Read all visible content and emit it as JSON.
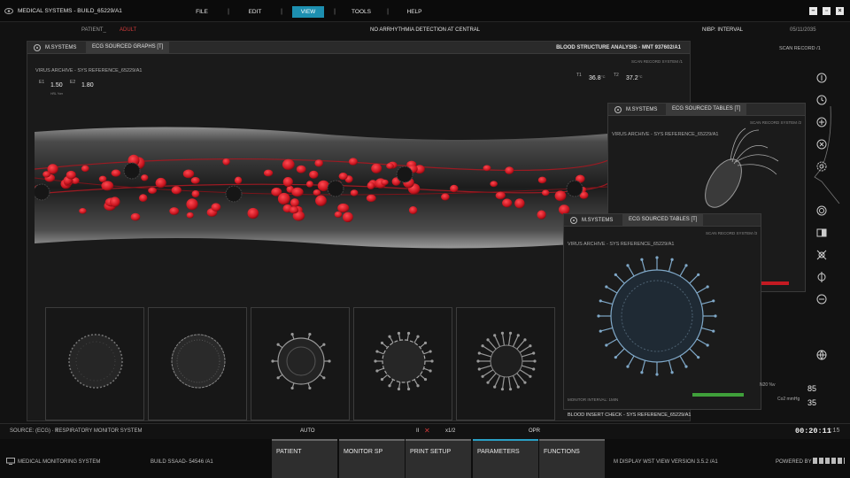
{
  "app": {
    "title": "MEDICAL SYSTEMS - BUILD_65229/A1"
  },
  "menu": [
    {
      "label": "FILE"
    },
    {
      "label": "EDIT"
    },
    {
      "label": "VIEW"
    },
    {
      "label": "TOOLS"
    },
    {
      "label": "HELP"
    }
  ],
  "status": {
    "patient": "PATIENT_",
    "adult": "ADULT",
    "center": "NO ARRHYTHMIA DETECTION AT CENTRAL",
    "nibp": "NIBP: INTERVAL",
    "date": "05/11/2035",
    "scan_record": "SCAN RECORD /1"
  },
  "main_panel": {
    "header_left": "M.SYSTEMS",
    "header_tab": "ECG SOURCED GRAPHS [T]",
    "header_right": "BLOOD STRUCTURE ANALYSIS - MNT 937602/A1",
    "subhead_right": "SCAN RECORD SYSTEM /1",
    "archive": "VIRUS ARCHIVE - SYS REFERENCE_65229/A1",
    "readings": {
      "e1_label": "E1",
      "e1_value": "1.50",
      "e1_unit": "HRL %er",
      "e2_label": "E2",
      "e2_value": "1.80",
      "t1_label": "T1",
      "t1_value": "36.8",
      "t1_unit": "°C",
      "t2_label": "T2",
      "t2_value": "37.2",
      "t2_unit": "°C"
    }
  },
  "panel_tables": {
    "header_left": "M.SYSTEMS",
    "header_tab": "ECG SOURCED TABLES [T]",
    "subhead": "SCAN RECORD SYSTEM /2",
    "archive": "VIRUS ARCHIVE - SYS REFERENCE_65229/A1"
  },
  "panel_ecg2": {
    "header_left": "M.SYSTEMS",
    "header_tab": "ECG SOURCED TABLES [T]",
    "subhead": "SCAN RECORD SYSTEM /3",
    "archive": "VIRUS ARCHIVE - SYS REFERENCE_65229/A1",
    "monitor_interval": "MONITOR INTERVAL: 1MIN",
    "footer": "BLOOD INSERT CHECK - SYS REFERENCE_65229/A1"
  },
  "vitals": {
    "n20_label": "N20 %v",
    "n20_value": "85",
    "co2_label": "Co2 mmHg",
    "co2_value": "35"
  },
  "sourcebar": {
    "source": "SOURCE: (ECG) · T",
    "system": "RESPIRATORY MONITOR SYSTEM",
    "auto": "AUTO",
    "ii": "II",
    "x12": "x1/2",
    "opr": "OPR",
    "timer": "00:20:11",
    "timer_frac": ":15"
  },
  "footer": {
    "system": "MEDICAL MONITORING SYSTEM",
    "build": "BUILD SSAAD- 54546 /A1",
    "tabs": [
      {
        "label": "PATIENT"
      },
      {
        "label": "MONITOR SP"
      },
      {
        "label": "PRINT SETUP"
      },
      {
        "label": "PARAMETERS"
      },
      {
        "label": "FUNCTIONS"
      }
    ],
    "version": "M DISPLAY WST VIEW VERSION 3.5.2 /A1",
    "powered": "POWERED BY"
  },
  "colors": {
    "accent": "#1d8fb0",
    "alert": "#d03a3a",
    "ok": "#3fa03a",
    "cell": "#c8141e"
  },
  "icons": [
    "eye-icon",
    "info-icon",
    "clock-icon",
    "add-icon",
    "close-circle-icon",
    "settings-icon",
    "target-icon",
    "split-view-icon",
    "cross-icon",
    "minus-icon",
    "globe-icon"
  ]
}
